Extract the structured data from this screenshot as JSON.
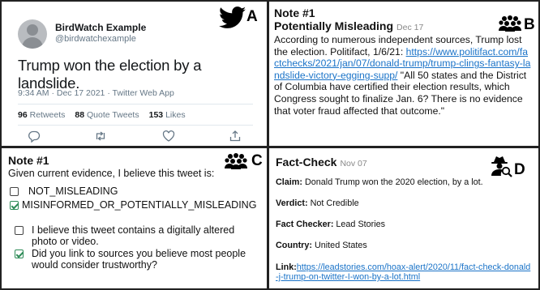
{
  "panelA": {
    "letter": "A",
    "name": "BirdWatch Example",
    "handle": "@birdwatchexample",
    "text": "Trump won the election by a landslide.",
    "meta": "9:34 AM · Dec 17 2021 · Twitter Web App",
    "retweets_count": "96",
    "retweets_label": "Retweets",
    "quotes_count": "88",
    "quotes_label": "Quote Tweets",
    "likes_count": "153",
    "likes_label": "Likes",
    "icons": [
      "twitter-bird-icon",
      "reply-icon",
      "retweet-icon",
      "like-icon",
      "share-icon"
    ]
  },
  "panelB": {
    "letter": "B",
    "title": "Note #1",
    "subtitle": "Potentially Misleading",
    "date": "Dec 17",
    "text_before": "According to numerous independent sources, Trump lost the election.   Politifact, 1/6/21: ",
    "link": "https://www.politifact.com/factchecks/2021/jan/07/donald-trump/trump-clings-fantasy-landslide-victory-egging-supp/",
    "text_after": " \"All 50 states and the District of Columbia have certified their election results, which Congress sought to finalize Jan. 6? There is no evidence that voter fraud affected that outcome.\"",
    "icon": "crowd-icon"
  },
  "panelC": {
    "letter": "C",
    "title": "Note #1",
    "question": "Given current evidence, I believe this tweet is:",
    "options": [
      {
        "label": "NOT_MISLEADING",
        "checked": false
      },
      {
        "label": "MISINFORMED_OR_POTENTIALLY_MISLEADING",
        "checked": true
      },
      {
        "label": "I believe this tweet contains a digitally altered photo or video.",
        "checked": false
      },
      {
        "label": "Did you link to sources you believe most people would consider trustworthy?",
        "checked": true
      }
    ],
    "icon": "crowd-icon"
  },
  "panelD": {
    "letter": "D",
    "title": "Fact-Check",
    "date": "Nov 07",
    "claim_label": "Claim:",
    "claim": " Donald Trump won the 2020 election, by a lot.",
    "verdict_label": "Verdict:",
    "verdict": " Not Credible",
    "checker_label": "Fact Checker:",
    "checker": " Lead Stories",
    "country_label": "Country:",
    "country": " United States",
    "link_label": "Link:",
    "link": "https://leadstories.com/hoax-alert/2020/11/fact-check-donald-j-trump-on-twitter-I-won-by-a-lot.html",
    "icon": "detective-icon"
  }
}
